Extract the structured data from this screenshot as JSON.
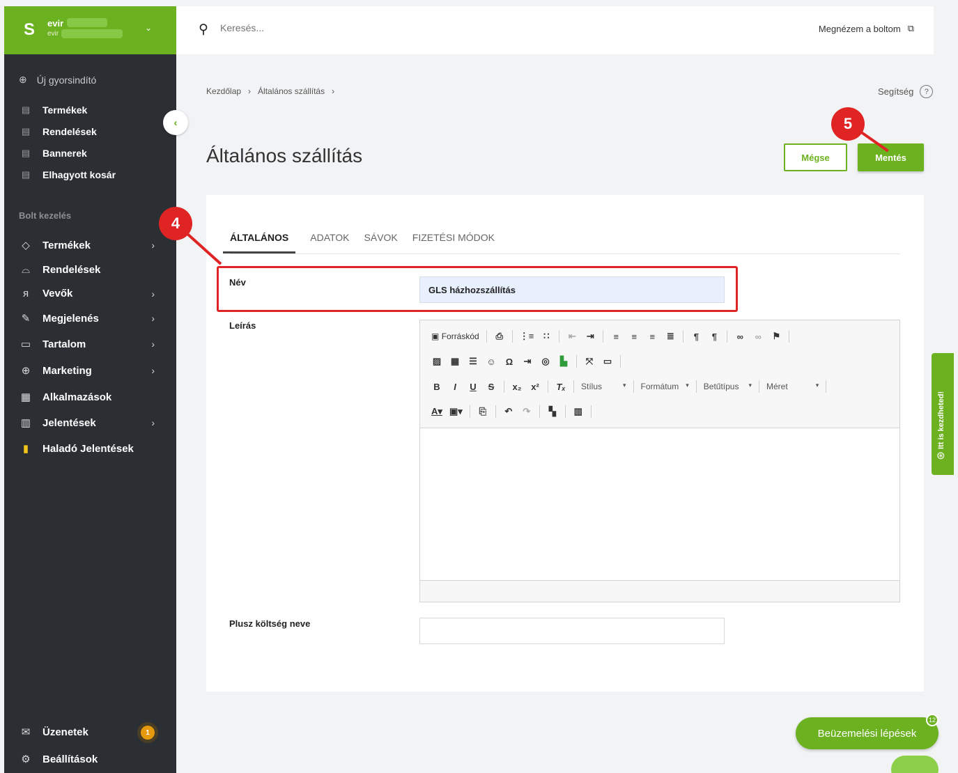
{
  "sidebar": {
    "store_name": "evir",
    "store_sub": "evir",
    "quick_launch": "Új gyorsindító",
    "pinned": [
      "Termékek",
      "Rendelések",
      "Bannerek",
      "Elhagyott kosár"
    ],
    "section_title": "Bolt kezelés",
    "menu": [
      {
        "label": "Termékek",
        "icon": "tag-icon"
      },
      {
        "label": "Rendelések",
        "icon": "basket-icon"
      },
      {
        "label": "Vevők",
        "icon": "users-icon"
      },
      {
        "label": "Megjelenés",
        "icon": "brush-icon"
      },
      {
        "label": "Tartalom",
        "icon": "document-icon"
      },
      {
        "label": "Marketing",
        "icon": "globe-icon"
      },
      {
        "label": "Alkalmazások",
        "icon": "apps-icon"
      },
      {
        "label": "Jelentések",
        "icon": "chart-icon"
      },
      {
        "label": "Haladó Jelentések",
        "icon": "advanced-chart-icon"
      }
    ],
    "messages": "Üzenetek",
    "messages_count": "1",
    "settings": "Beállítások"
  },
  "topbar": {
    "search_placeholder": "Keresés...",
    "view_store": "Megnézem a boltom"
  },
  "breadcrumb": [
    "Kezdőlap",
    "Általános szállítás"
  ],
  "help": "Segítség",
  "page_title": "Általános szállítás",
  "buttons": {
    "cancel": "Mégse",
    "save": "Mentés"
  },
  "tabs": [
    "ÁLTALÁNOS",
    "ADATOK",
    "SÁVOK",
    "FIZETÉSI MÓDOK"
  ],
  "form": {
    "name_label": "Név",
    "name_value": "GLS házhozszállítás",
    "description_label": "Leírás",
    "extra_cost_label": "Plusz költség neve",
    "extra_cost_value": ""
  },
  "editor": {
    "source": "Forráskód",
    "style": "Stílus",
    "format": "Formátum",
    "font": "Betűtípus",
    "size": "Méret"
  },
  "annotations": {
    "step4": "4",
    "step5": "5"
  },
  "side_help": "Itt is kezdheted!",
  "onboarding": {
    "label": "Beüzemelési lépések",
    "count": "12"
  },
  "colors": {
    "accent": "#6bb120",
    "sidebar": "#2b2e33",
    "annotation": "#e02424"
  }
}
